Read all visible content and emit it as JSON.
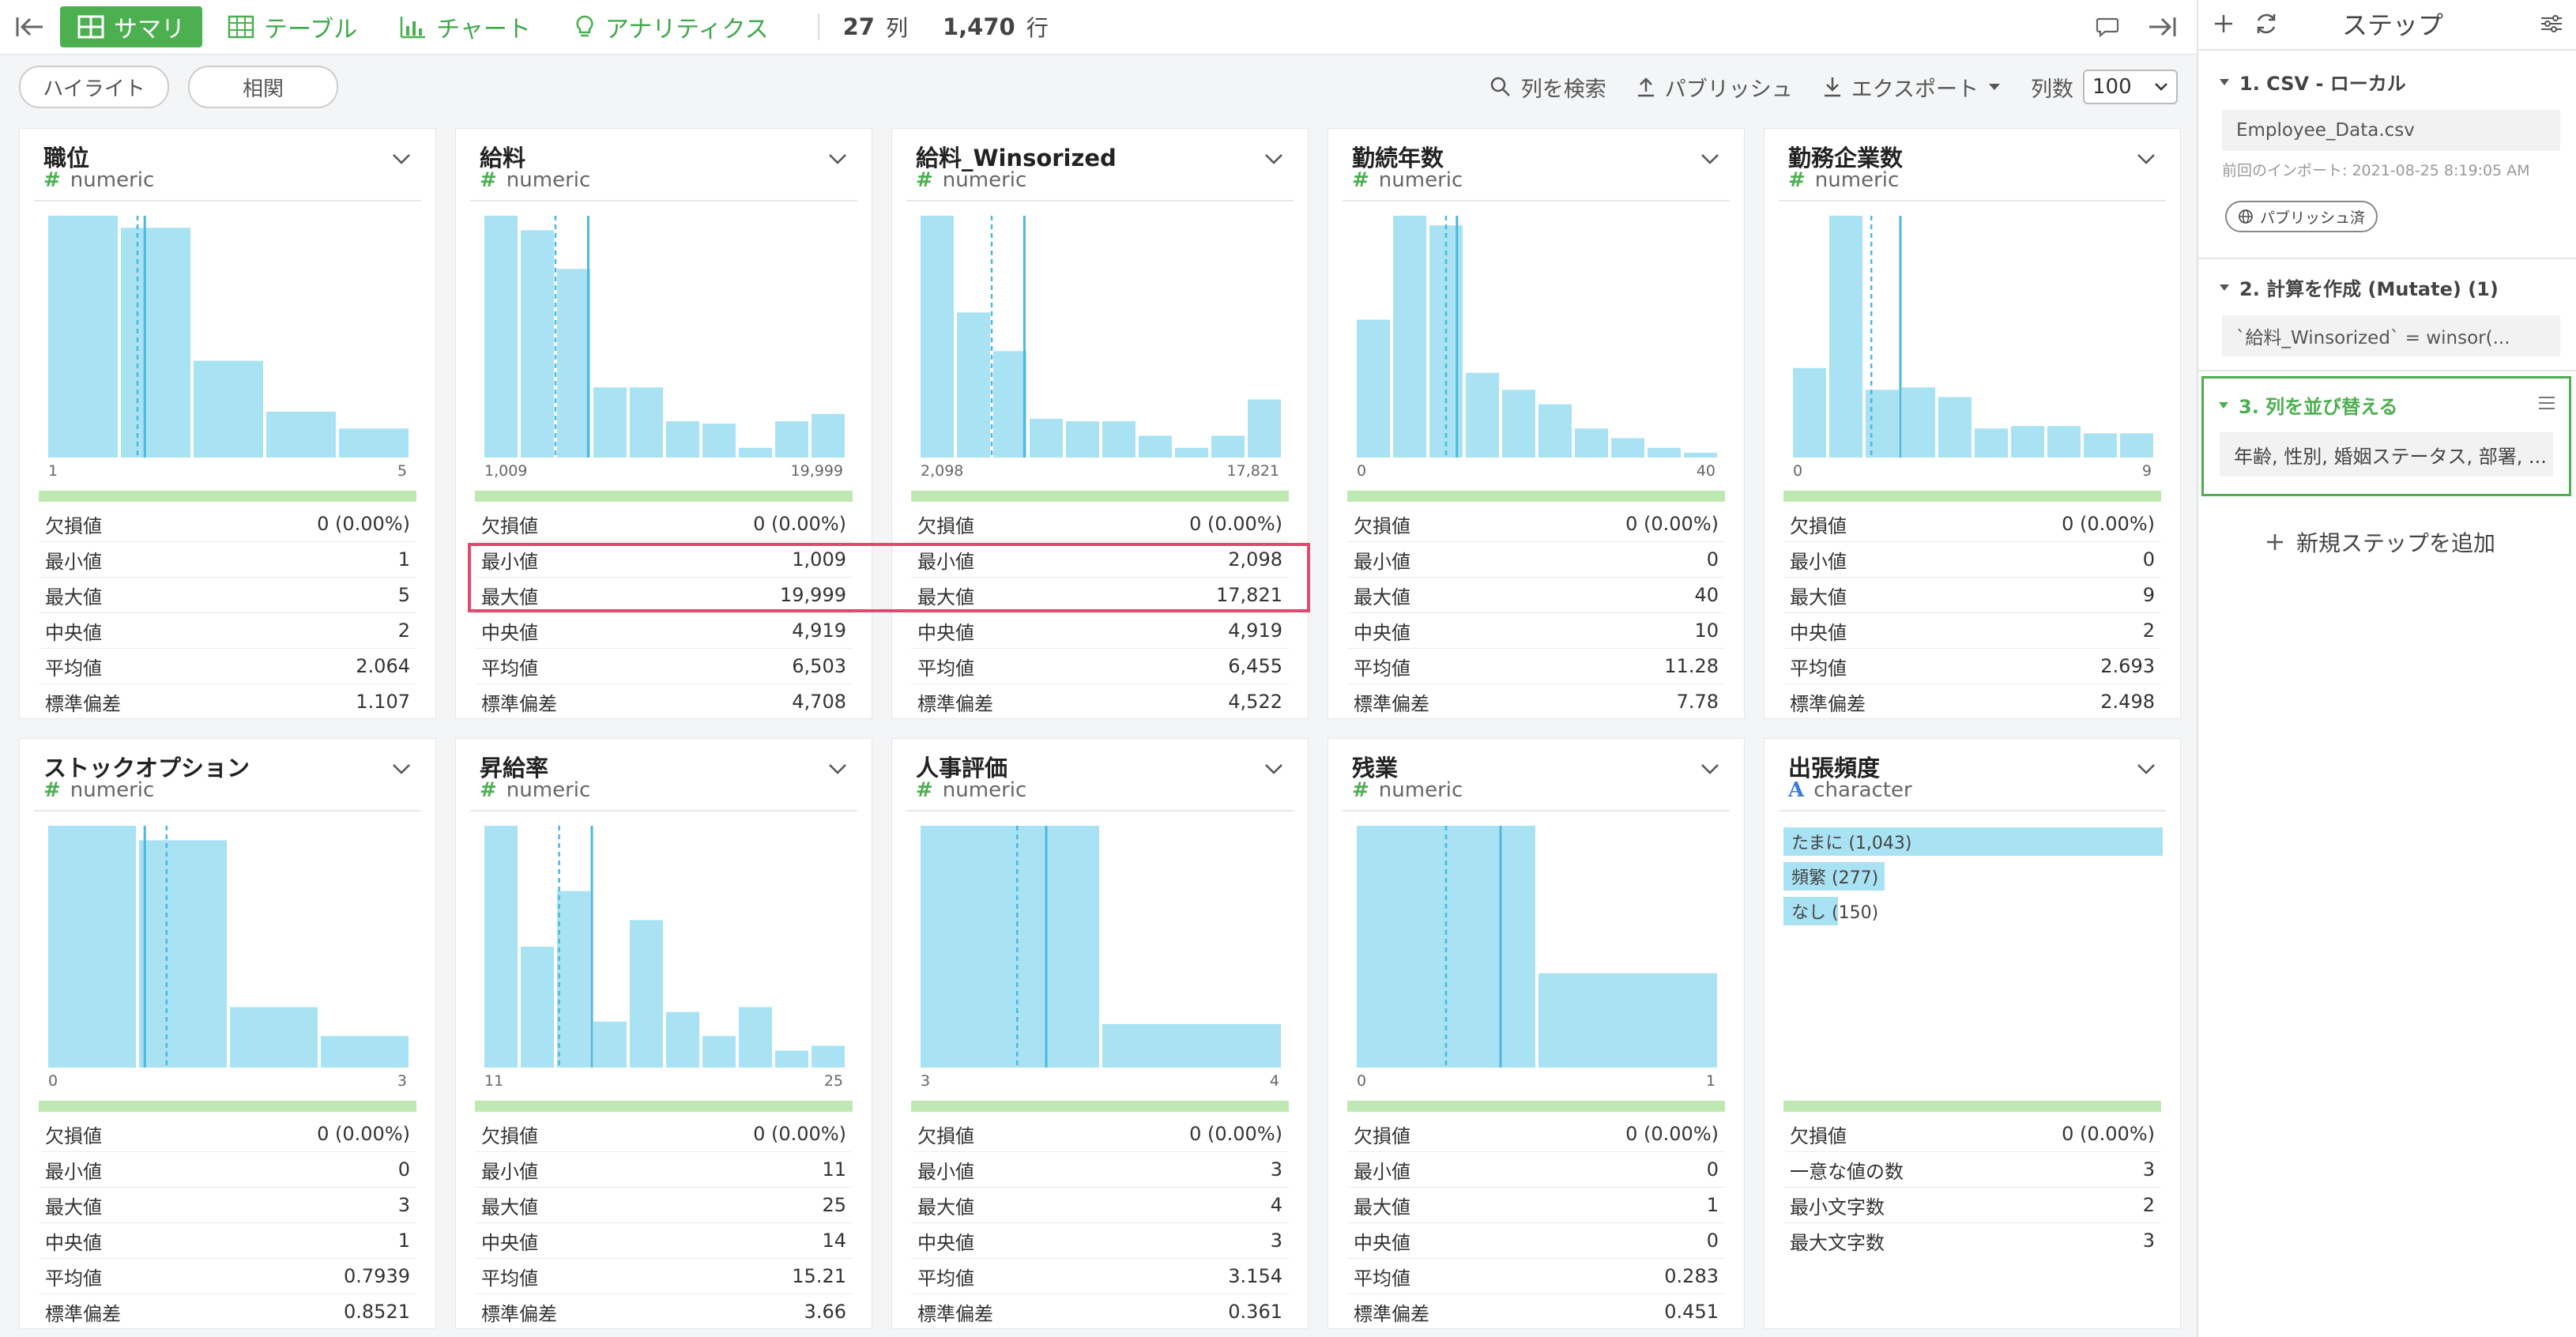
{
  "toolbar": {
    "tabs": [
      {
        "label": "サマリ",
        "icon": "summary-grid-icon"
      },
      {
        "label": "テーブル",
        "icon": "table-icon"
      },
      {
        "label": "チャート",
        "icon": "bar-chart-icon"
      },
      {
        "label": "アナリティクス",
        "icon": "bulb-icon"
      }
    ],
    "columns_count": "27",
    "columns_label": "列",
    "rows_count": "1,470",
    "rows_label": "行"
  },
  "subbar": {
    "highlight_button": "ハイライト",
    "correlation_button": "相関",
    "search_label": "列を検索",
    "publish_label": "パブリッシュ",
    "export_label": "エクスポート",
    "columns_per_page_label": "列数",
    "columns_per_page_value": "100"
  },
  "accent_color": "#4caf50",
  "highlight_color": "#e04a6e",
  "cards": [
    {
      "title": "職位",
      "type": "numeric",
      "kind": "numeric",
      "hist": [
        1,
        0.95,
        0.4,
        0.19,
        0.12
      ],
      "median_frac": 0.25,
      "mean_frac": 0.27,
      "axis_min": "1",
      "axis_max": "5",
      "stats": [
        [
          "欠損値",
          "0 (0.00%)"
        ],
        [
          "最小値",
          "1"
        ],
        [
          "最大値",
          "5"
        ],
        [
          "中央値",
          "2"
        ],
        [
          "平均値",
          "2.064"
        ],
        [
          "標準偏差",
          "1.107"
        ]
      ]
    },
    {
      "title": "給料",
      "type": "numeric",
      "kind": "numeric",
      "hist": [
        1,
        0.94,
        0.78,
        0.29,
        0.29,
        0.15,
        0.14,
        0.04,
        0.15,
        0.18
      ],
      "median_frac": 0.2,
      "mean_frac": 0.29,
      "axis_min": "1,009",
      "axis_max": "19,999",
      "stats": [
        [
          "欠損値",
          "0 (0.00%)"
        ],
        [
          "最小値",
          "1,009"
        ],
        [
          "最大値",
          "19,999"
        ],
        [
          "中央値",
          "4,919"
        ],
        [
          "平均値",
          "6,503"
        ],
        [
          "標準偏差",
          "4,708"
        ]
      ]
    },
    {
      "title": "給料_Winsorized",
      "type": "numeric",
      "kind": "numeric",
      "hist": [
        1,
        0.6,
        0.44,
        0.16,
        0.15,
        0.15,
        0.09,
        0.04,
        0.09,
        0.24
      ],
      "median_frac": 0.2,
      "mean_frac": 0.29,
      "axis_min": "2,098",
      "axis_max": "17,821",
      "stats": [
        [
          "欠損値",
          "0 (0.00%)"
        ],
        [
          "最小値",
          "2,098"
        ],
        [
          "最大値",
          "17,821"
        ],
        [
          "中央値",
          "4,919"
        ],
        [
          "平均値",
          "6,455"
        ],
        [
          "標準偏差",
          "4,522"
        ]
      ]
    },
    {
      "title": "勤続年数",
      "type": "numeric",
      "kind": "numeric",
      "hist": [
        0.57,
        1,
        0.96,
        0.35,
        0.28,
        0.22,
        0.12,
        0.08,
        0.04,
        0.02
      ],
      "median_frac": 0.25,
      "mean_frac": 0.28,
      "axis_min": "0",
      "axis_max": "40",
      "stats": [
        [
          "欠損値",
          "0 (0.00%)"
        ],
        [
          "最小値",
          "0"
        ],
        [
          "最大値",
          "40"
        ],
        [
          "中央値",
          "10"
        ],
        [
          "平均値",
          "11.28"
        ],
        [
          "標準偏差",
          "7.78"
        ]
      ]
    },
    {
      "title": "勤務企業数",
      "type": "numeric",
      "kind": "numeric",
      "hist": [
        0.37,
        1,
        0.28,
        0.29,
        0.25,
        0.12,
        0.13,
        0.13,
        0.1,
        0.1
      ],
      "median_frac": 0.22,
      "mean_frac": 0.3,
      "axis_min": "0",
      "axis_max": "9",
      "stats": [
        [
          "欠損値",
          "0 (0.00%)"
        ],
        [
          "最小値",
          "0"
        ],
        [
          "最大値",
          "9"
        ],
        [
          "中央値",
          "2"
        ],
        [
          "平均値",
          "2.693"
        ],
        [
          "標準偏差",
          "2.498"
        ]
      ]
    },
    {
      "title": "ストックオプション",
      "type": "numeric",
      "kind": "numeric",
      "hist": [
        1,
        0.94,
        0.25,
        0.13
      ],
      "median_frac": 0.33,
      "mean_frac": 0.27,
      "axis_min": "0",
      "axis_max": "3",
      "stats": [
        [
          "欠損値",
          "0 (0.00%)"
        ],
        [
          "最小値",
          "0"
        ],
        [
          "最大値",
          "3"
        ],
        [
          "中央値",
          "1"
        ],
        [
          "平均値",
          "0.7939"
        ],
        [
          "標準偏差",
          "0.8521"
        ]
      ]
    },
    {
      "title": "昇給率",
      "type": "numeric",
      "kind": "numeric",
      "hist": [
        1,
        0.5,
        0.73,
        0.19,
        0.61,
        0.23,
        0.13,
        0.25,
        0.07,
        0.09
      ],
      "median_frac": 0.21,
      "mean_frac": 0.3,
      "axis_min": "11",
      "axis_max": "25",
      "stats": [
        [
          "欠損値",
          "0 (0.00%)"
        ],
        [
          "最小値",
          "11"
        ],
        [
          "最大値",
          "25"
        ],
        [
          "中央値",
          "14"
        ],
        [
          "平均値",
          "15.21"
        ],
        [
          "標準偏差",
          "3.66"
        ]
      ]
    },
    {
      "title": "人事評価",
      "type": "numeric",
      "kind": "numeric",
      "hist": [
        1,
        0.18
      ],
      "median_frac": 0.27,
      "mean_frac": 0.35,
      "axis_min": "3",
      "axis_max": "4",
      "stats": [
        [
          "欠損値",
          "0 (0.00%)"
        ],
        [
          "最小値",
          "3"
        ],
        [
          "最大値",
          "4"
        ],
        [
          "中央値",
          "3"
        ],
        [
          "平均値",
          "3.154"
        ],
        [
          "標準偏差",
          "0.361"
        ]
      ]
    },
    {
      "title": "残業",
      "type": "numeric",
      "kind": "numeric",
      "hist": [
        1,
        0.39
      ],
      "median_frac": 0.25,
      "mean_frac": 0.4,
      "axis_min": "0",
      "axis_max": "1",
      "stats": [
        [
          "欠損値",
          "0 (0.00%)"
        ],
        [
          "最小値",
          "0"
        ],
        [
          "最大値",
          "1"
        ],
        [
          "中央値",
          "0"
        ],
        [
          "平均値",
          "0.283"
        ],
        [
          "標準偏差",
          "0.451"
        ]
      ]
    },
    {
      "title": "出張頻度",
      "type": "character",
      "kind": "character",
      "categories": [
        {
          "label": "たまに (1,043)",
          "frac": 1
        },
        {
          "label": "頻繁 (277)",
          "frac": 0.266
        },
        {
          "label": "なし (150)",
          "frac": 0.144
        }
      ],
      "stats": [
        [
          "欠損値",
          "0 (0.00%)"
        ],
        [
          "一意な値の数",
          "3"
        ],
        [
          "最小文字数",
          "2"
        ],
        [
          "最大文字数",
          "3"
        ]
      ]
    }
  ],
  "sidebar": {
    "title": "ステップ",
    "step1": {
      "header": "1. CSV - ローカル",
      "file": "Employee_Data.csv",
      "note": "前回のインポート: 2021-08-25 8:19:05 AM",
      "badge": "パブリッシュ済"
    },
    "step2": {
      "header": "2. 計算を作成 (Mutate) (1)",
      "expr": "`給料_Winsorized` = winsor(..."
    },
    "step3": {
      "header": "3. 列を並び替える",
      "columns": "年齢, 性別, 婚姻ステータス, 部署, ..."
    },
    "add_step": "新規ステップを追加"
  }
}
